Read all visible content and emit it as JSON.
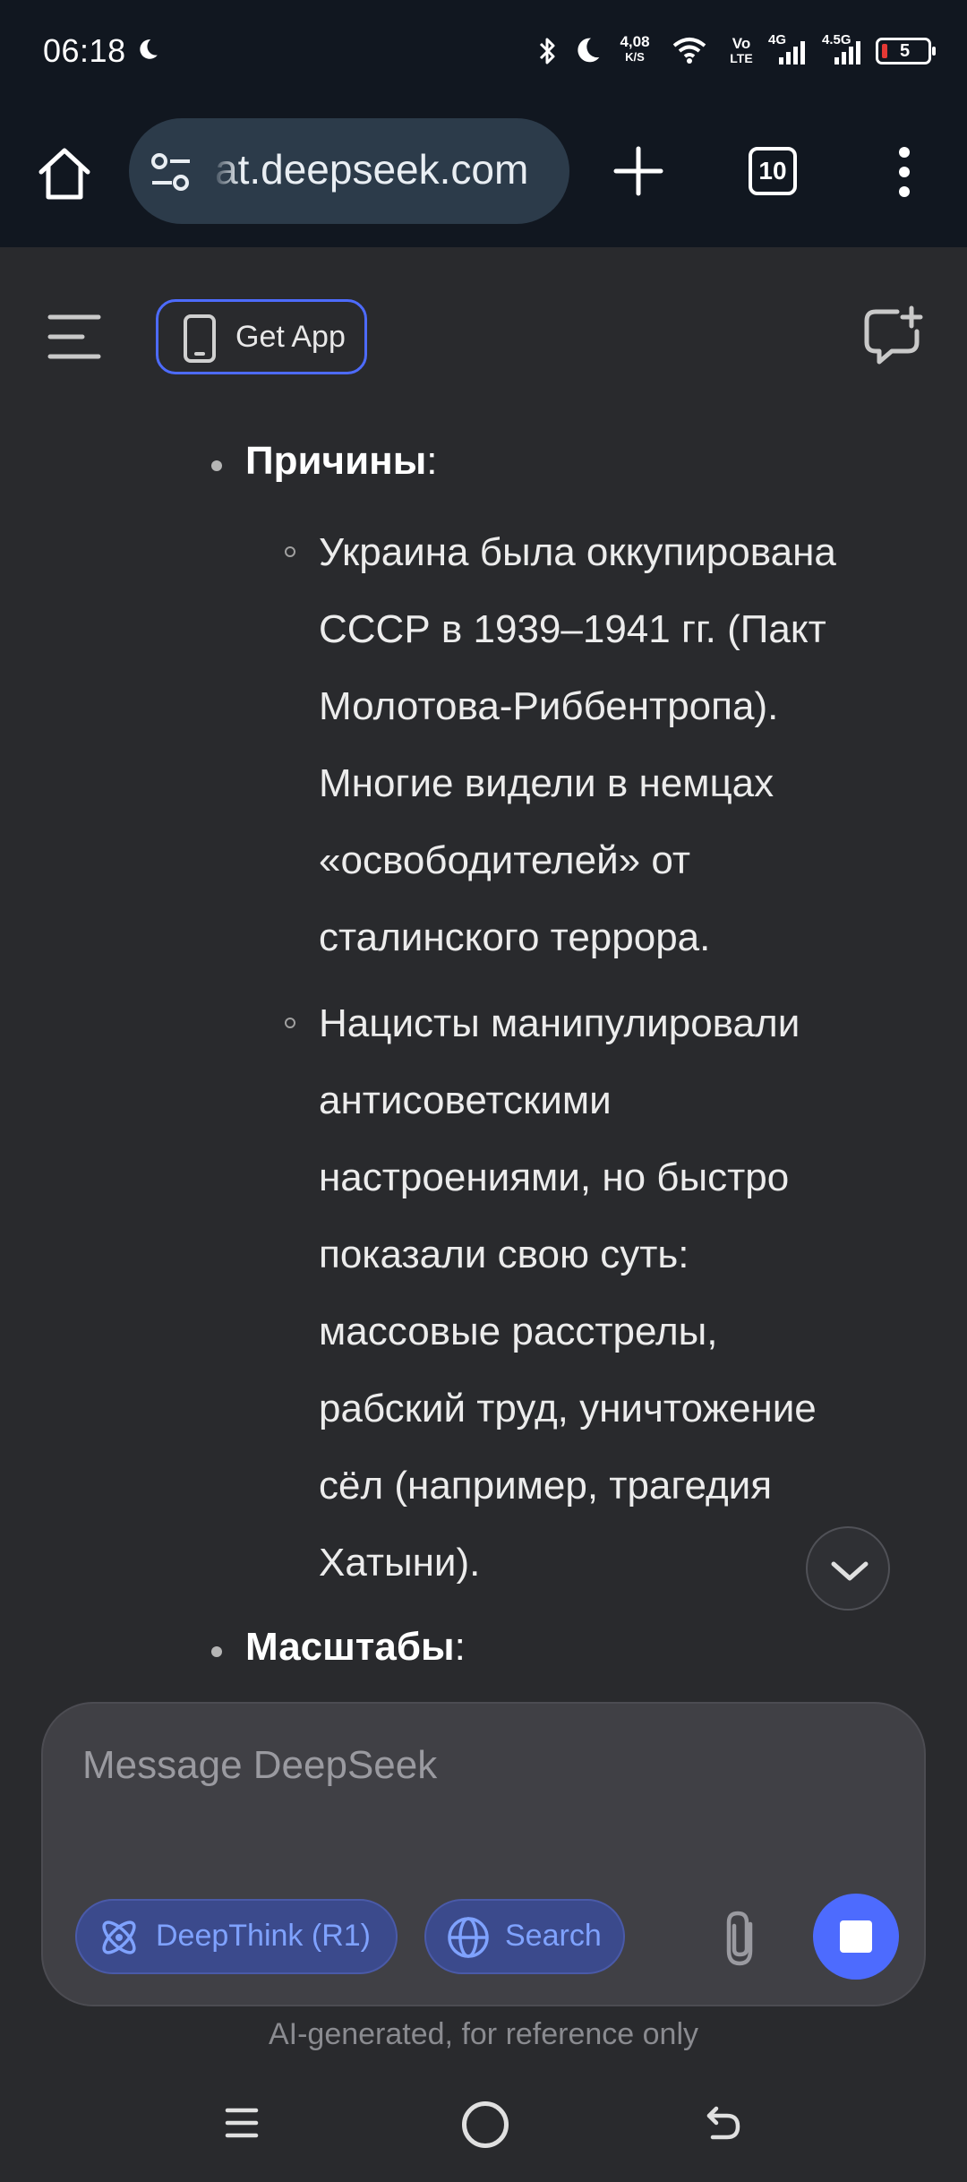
{
  "status_bar": {
    "time": "06:18",
    "net_speed_top": "4,08",
    "net_speed_bottom": "K/S",
    "volte_top": "Vo",
    "volte_bottom": "LTE",
    "sig1_label": "4G",
    "sig2_label": "4.5G",
    "battery": "5",
    "icons": [
      "moon-icon",
      "bluetooth-icon",
      "moon-icon",
      "wifi-icon",
      "signal-icon",
      "signal-icon",
      "battery-icon"
    ]
  },
  "browser": {
    "url": "at.deepseek.com",
    "tab_count": "10",
    "icons": [
      "home-icon",
      "site-settings-icon",
      "plus-icon",
      "tabs-icon",
      "more-vert-icon"
    ]
  },
  "app_header": {
    "get_app_label": "Get App",
    "icons": [
      "menu-icon",
      "phone-icon",
      "new-chat-icon"
    ]
  },
  "content": {
    "section1_title": "Причины",
    "section1_items": [
      {
        "lines": [
          "Украина была оккупирована",
          "СССР в 1939–1941 гг. (Пакт",
          "Молотова-Риббентропа).",
          "Многие видели в немцах",
          "«освободителей» от",
          "сталинского террора."
        ]
      },
      {
        "lines": [
          "Нацисты манипулировали",
          "антисоветскими",
          "настроениями, но быстро",
          "показали свою суть:",
          "массовые расстрелы,",
          "рабский труд, уничтожение",
          "сёл (например, трагедия",
          "Хатыни)."
        ]
      }
    ],
    "section2_title": "Масштабы",
    "colon": ":"
  },
  "composer": {
    "placeholder": "Message DeepSeek",
    "deepthink_label": "DeepThink (R1)",
    "search_label": "Search",
    "icons": [
      "atom-icon",
      "globe-icon",
      "paperclip-icon",
      "stop-icon"
    ]
  },
  "disclaimer": "AI-generated, for reference only",
  "colors": {
    "accent": "#4d6bfe",
    "background": "#292a2d",
    "chrome": "#111720",
    "chip_text": "#7fa2ff"
  }
}
